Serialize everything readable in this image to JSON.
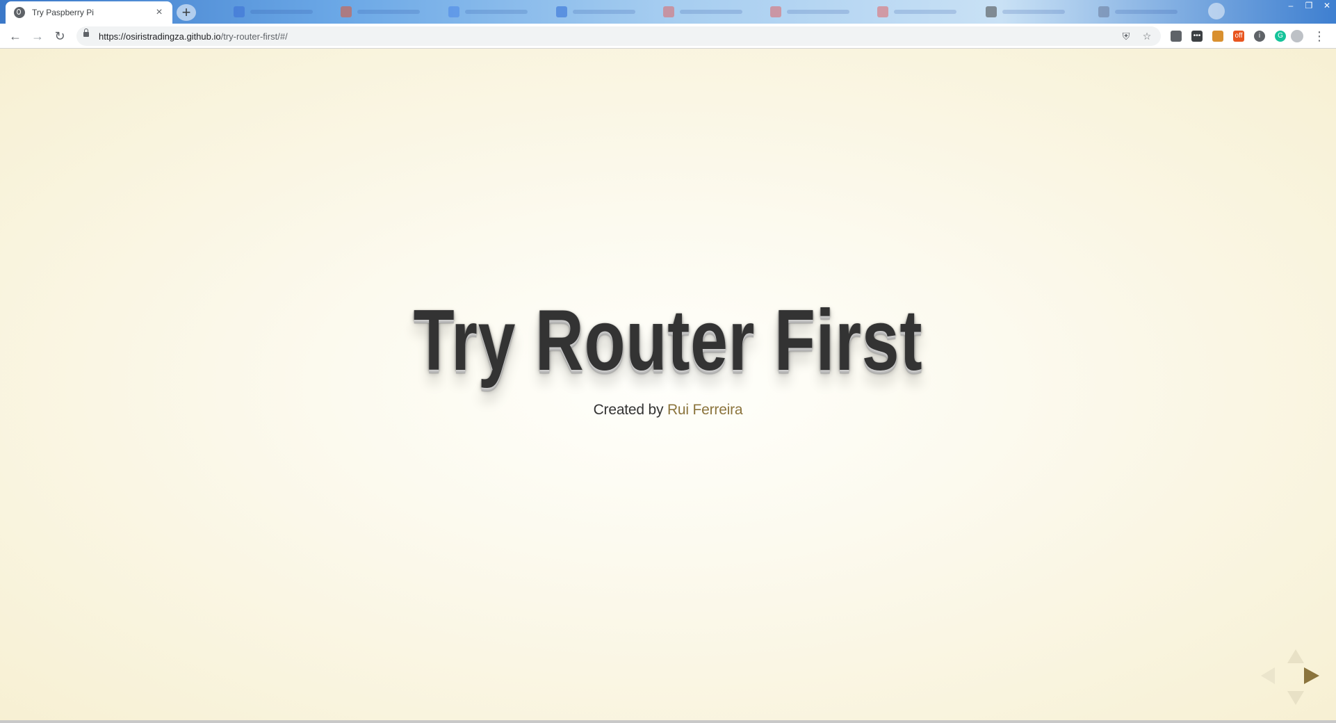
{
  "browser": {
    "active_tab": {
      "title": "Try Paspberry Pi",
      "close_glyph": "×"
    },
    "new_tab_glyph": "+",
    "background_tabs": [
      {
        "favicon_color": "#3b6fd6"
      },
      {
        "favicon_color": "#e0552f"
      },
      {
        "favicon_color": "#4a86e8"
      },
      {
        "favicon_color": "#2d6bd6"
      },
      {
        "favicon_color": "#e06666"
      },
      {
        "favicon_color": "#e06666"
      },
      {
        "favicon_color": "#e06666"
      },
      {
        "favicon_color": "#444444"
      },
      {
        "favicon_color": "#6a7a9a"
      }
    ],
    "window_controls": {
      "minimize": "–",
      "restore": "❐",
      "close": "✕"
    },
    "toolbar": {
      "back_glyph": "←",
      "forward_glyph": "→",
      "reload_glyph": "↻",
      "url_host": "https://osiristradingza.github.io",
      "url_path": "/try-router-first/#/",
      "star_glyph": "☆",
      "menu_glyph": "⋮"
    },
    "extensions": [
      {
        "name": "shield-extension-icon",
        "color": "#5f6368",
        "glyph": ""
      },
      {
        "name": "password-extension-icon",
        "color": "#3c4043",
        "glyph": "•••"
      },
      {
        "name": "cookie-extension-icon",
        "color": "#d9902f",
        "glyph": ""
      },
      {
        "name": "off-extension-icon",
        "color": "#e8551f",
        "glyph": "off"
      },
      {
        "name": "info-extension-icon",
        "color": "#5f6368",
        "glyph": "i"
      },
      {
        "name": "grammarly-extension-icon",
        "color": "#15c39a",
        "glyph": "G"
      }
    ]
  },
  "slide": {
    "title": "Try Router First",
    "subtitle_prefix": "Created by",
    "author": "Rui Ferreira"
  },
  "colors": {
    "title": "#333333",
    "accent": "#8b743d",
    "background": "#f7f0d3"
  }
}
